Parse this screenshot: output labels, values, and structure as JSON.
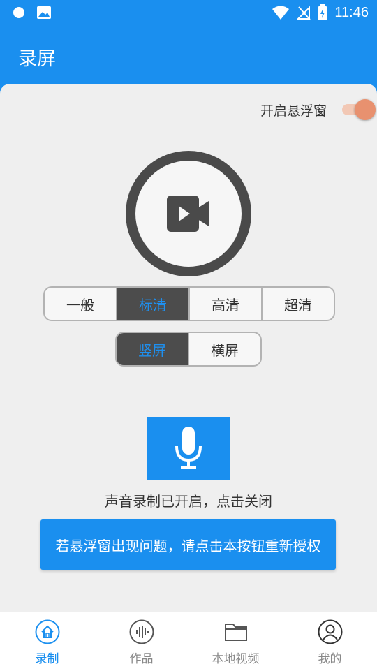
{
  "status_bar": {
    "time": "11:46"
  },
  "app_bar": {
    "title": "录屏"
  },
  "floating_window": {
    "label": "开启悬浮窗",
    "enabled": true
  },
  "record_button": {
    "icon": "video-camera-icon"
  },
  "quality": {
    "options": [
      "一般",
      "标清",
      "高清",
      "超清"
    ],
    "selected": "标清"
  },
  "orientation": {
    "options": [
      "竖屏",
      "横屏"
    ],
    "selected": "竖屏"
  },
  "audio": {
    "icon": "microphone-icon",
    "status_text": "声音录制已开启，点击关闭"
  },
  "reauth_button": {
    "label": "若悬浮窗出现问题，请点击本按钮重新授权"
  },
  "bottom_nav": {
    "items": [
      {
        "label": "录制",
        "icon": "home-icon"
      },
      {
        "label": "作品",
        "icon": "audio-wave-icon"
      },
      {
        "label": "本地视频",
        "icon": "folder-icon"
      },
      {
        "label": "我的",
        "icon": "user-icon"
      }
    ],
    "active": "录制"
  },
  "colors": {
    "primary": "#1a8fef",
    "accent": "#e8916f",
    "dark": "#4a4a4a"
  }
}
